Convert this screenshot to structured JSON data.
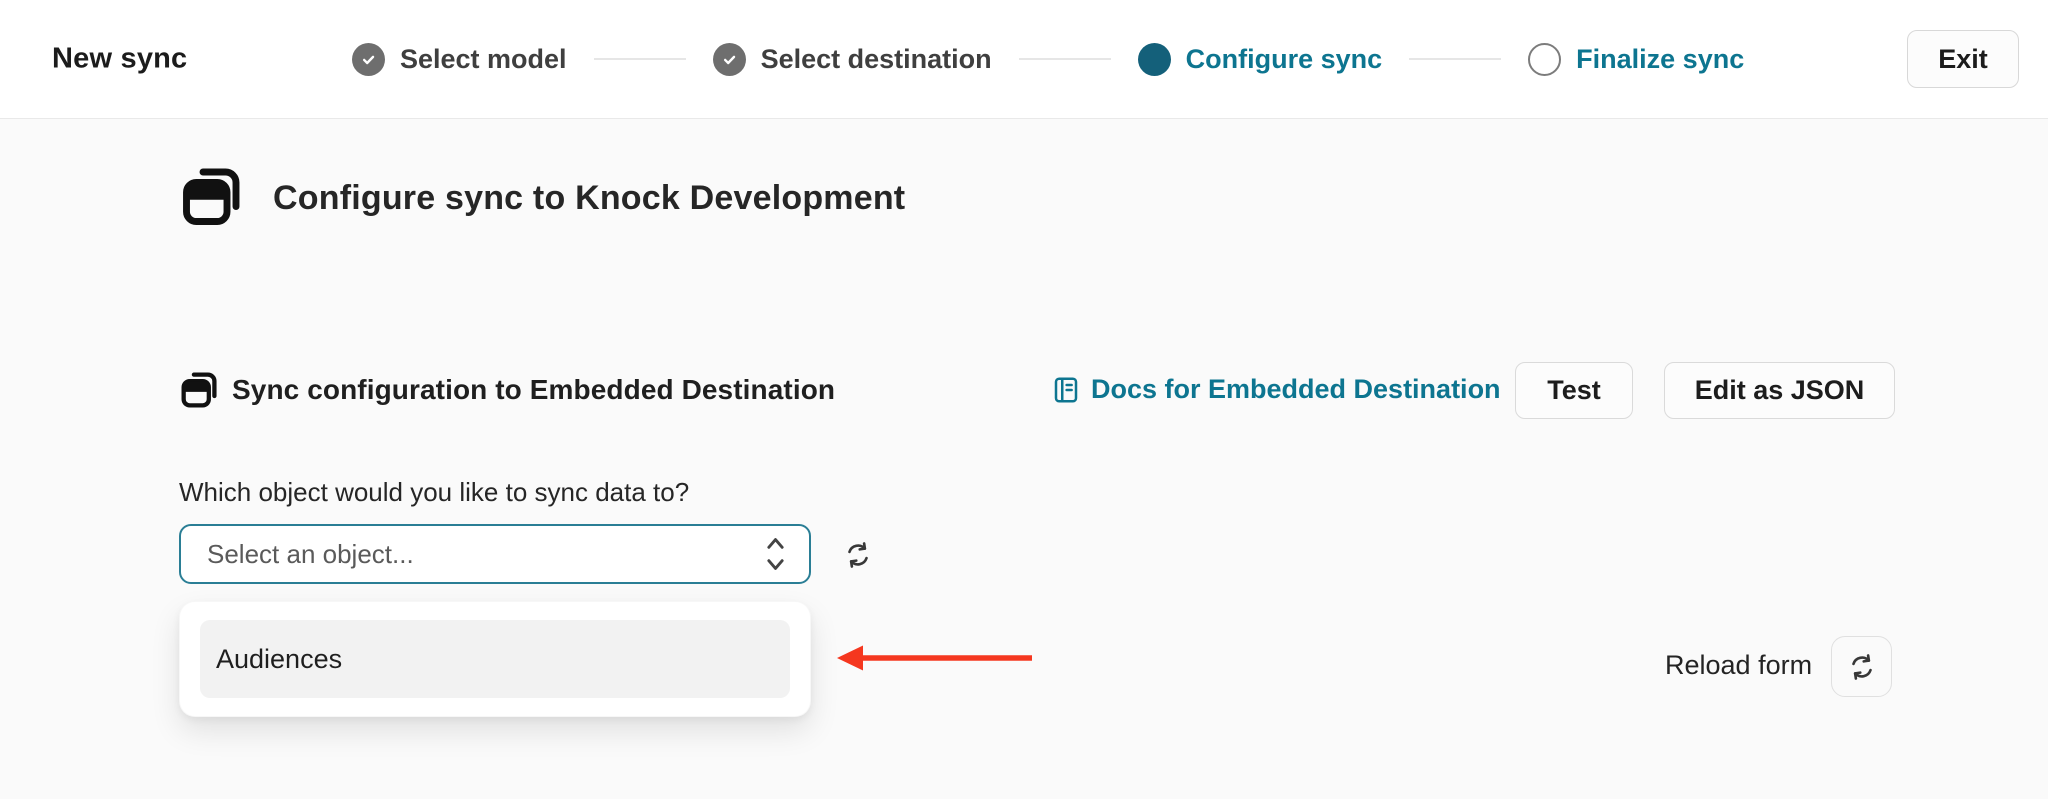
{
  "header": {
    "title": "New sync",
    "steps": [
      {
        "label": "Select model",
        "state": "done"
      },
      {
        "label": "Select destination",
        "state": "done"
      },
      {
        "label": "Configure sync",
        "state": "active"
      },
      {
        "label": "Finalize sync",
        "state": "upcoming"
      }
    ],
    "exit_label": "Exit"
  },
  "main": {
    "heading": "Configure sync to Knock Development",
    "section": {
      "title": "Sync configuration to Embedded Destination",
      "docs_link_label": "Docs for Embedded Destination",
      "test_button_label": "Test",
      "edit_json_button_label": "Edit as JSON"
    },
    "object_field": {
      "question": "Which object would you like to sync data to?",
      "placeholder": "Select an object...",
      "options": [
        "Audiences"
      ]
    },
    "reload_form_label": "Reload form"
  },
  "icons": {
    "step_done": "check-circle",
    "step_active": "filled-circle",
    "step_upcoming": "outline-circle",
    "hero": "sync-windows",
    "docs": "book",
    "select": "chevron-up-down",
    "refresh": "arrows-clockwise",
    "annotation": "red-arrow-left"
  },
  "colors": {
    "accent_teal_text": "#0D7590",
    "accent_teal_circle": "#14607A",
    "select_focus_border": "#2A7E95",
    "annotation_red": "#F5371F",
    "page_background": "#FAFAFA",
    "header_background": "#FFFFFF"
  }
}
